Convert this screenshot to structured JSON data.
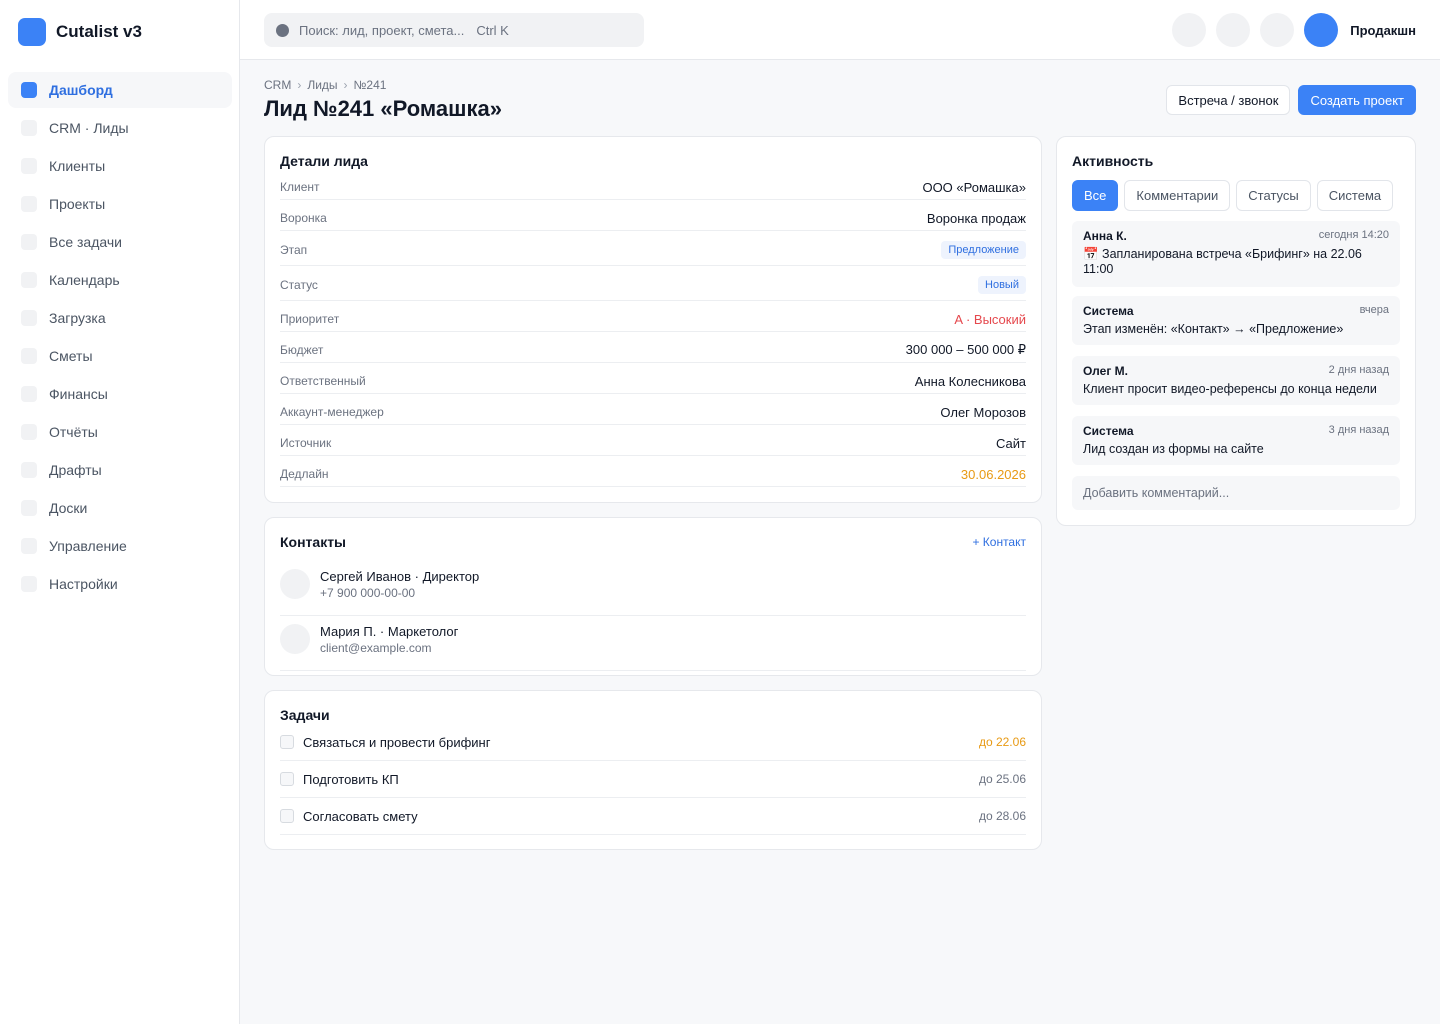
{
  "app": {
    "title": "Cutalist v3"
  },
  "sidebar": {
    "items": [
      {
        "label": "Дашборд",
        "active": true
      },
      {
        "label": "CRM · Лиды"
      },
      {
        "label": "Клиенты"
      },
      {
        "label": "Проекты"
      },
      {
        "label": "Все задачи"
      },
      {
        "label": "Календарь"
      },
      {
        "label": "Загрузка"
      },
      {
        "label": "Сметы"
      },
      {
        "label": "Финансы"
      },
      {
        "label": "Отчёты"
      },
      {
        "label": "Драфты"
      },
      {
        "label": "Доски"
      },
      {
        "label": "Управление"
      },
      {
        "label": "Настройки"
      }
    ]
  },
  "topbar": {
    "search_placeholder": "Поиск: лид, проект, смета...",
    "search_shortcut": "Ctrl K",
    "user_name": "Продакшн"
  },
  "breadcrumb": [
    "CRM",
    "Лиды",
    "№241"
  ],
  "breadcrumb_sep": "›",
  "page": {
    "title": "Лид №241 «Ромашка»",
    "btn_meeting": "Встреча / звонок",
    "btn_create": "Создать проект"
  },
  "details": {
    "title": "Детали лида",
    "rows": [
      {
        "key": "Клиент",
        "value": "ООО «Ромашка»"
      },
      {
        "key": "Воронка",
        "value": "Воронка продаж"
      },
      {
        "key": "Этап",
        "value": "Предложение",
        "badge": true
      },
      {
        "key": "Статус",
        "value": "Новый",
        "badge": true
      },
      {
        "key": "Приоритет",
        "value": "A · Высокий",
        "color": "#e5484d"
      },
      {
        "key": "Бюджет",
        "value": "300 000 – 500 000 ₽"
      },
      {
        "key": "Ответственный",
        "value": "Анна Колесникова"
      },
      {
        "key": "Аккаунт-менеджер",
        "value": "Олег Морозов"
      },
      {
        "key": "Источник",
        "value": "Сайт"
      },
      {
        "key": "Дедлайн",
        "value": "30.06.2026",
        "color": "#e89a14"
      }
    ]
  },
  "contacts": {
    "title": "Контакты",
    "add_label": "+ Контакт",
    "items": [
      {
        "name": "Сергей Иванов · Директор",
        "sub": "+7 900 000-00-00"
      },
      {
        "name": "Мария П. · Маркетолог",
        "sub": "client@example.com"
      }
    ]
  },
  "tasks": {
    "title": "Задачи",
    "items": [
      {
        "label": "Связаться и провести брифинг",
        "due": "до 22.06",
        "color": "#e89a14"
      },
      {
        "label": "Подготовить КП",
        "due": "до 25.06"
      },
      {
        "label": "Согласовать смету",
        "due": "до 28.06"
      }
    ]
  },
  "activity": {
    "title": "Активность",
    "tabs": [
      {
        "label": "Все",
        "active": true
      },
      {
        "label": "Комментарии"
      },
      {
        "label": "Статусы"
      },
      {
        "label": "Система"
      }
    ],
    "items": [
      {
        "author": "Анна К.",
        "time": "сегодня 14:20",
        "text": "📅 Запланирована встреча «Брифинг» на 22.06 11:00"
      },
      {
        "author": "Система",
        "time": "вчера",
        "text": "Этап изменён: «Контакт» → «Предложение»"
      },
      {
        "author": "Олег М.",
        "time": "2 дня назад",
        "text": "Клиент просит видео-референсы до конца недели"
      },
      {
        "author": "Система",
        "time": "3 дня назад",
        "text": "Лид создан из формы на сайте"
      }
    ],
    "comment_placeholder": "Добавить комментарий..."
  },
  "colors": {
    "accent": "#3b82f6",
    "danger": "#e5484d",
    "warning": "#e89a14"
  }
}
